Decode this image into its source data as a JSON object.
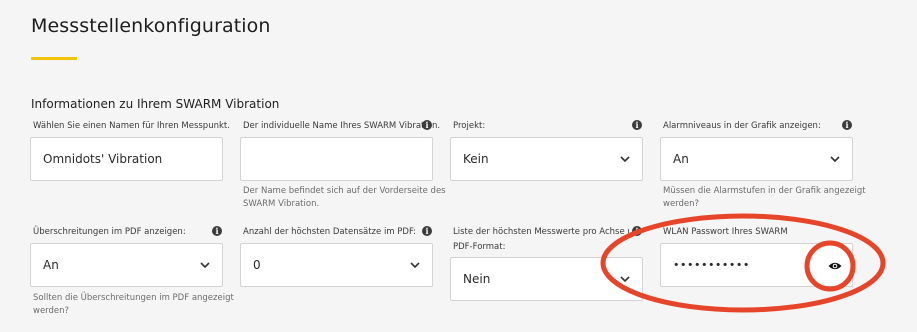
{
  "page": {
    "title": "Messstellenkonfiguration",
    "section_title": "Informationen zu Ihrem SWARM Vibration"
  },
  "fields": {
    "name": {
      "label": "Wählen Sie einen Namen für Ihren Messpunkt.",
      "value": "Omnidots' Vibration"
    },
    "individual_name": {
      "label": "Der individuelle Name Ihres SWARM Vibration.",
      "value": "",
      "hint_line1": "Der Name befindet sich auf der Vorderseite des",
      "hint_line2": "SWARM Vibration."
    },
    "project": {
      "label": "Projekt:",
      "value": "Kein"
    },
    "alarm_levels": {
      "label": "Alarmniveaus in der Grafik anzeigen:",
      "value": "An",
      "hint_line1": "Müssen die Alarmstufen in der Grafik angezeigt",
      "hint_line2": "werden?"
    },
    "exceedances_pdf": {
      "label": "Überschreitungen im PDF anzeigen:",
      "value": "An",
      "hint_line1": "Sollten die Überschreitungen im PDF angezeigt",
      "hint_line2": "werden?"
    },
    "max_records_pdf": {
      "label": "Anzahl der höchsten Datensätze im PDF:",
      "value": "0"
    },
    "peak_list_pdf": {
      "label_line1": "Liste der höchsten Messwerte pro Achse und Tag im",
      "label_line2": "PDF-Format:",
      "value": "Nein"
    },
    "wifi_password": {
      "label": "WLAN Passwort Ihres SWARM",
      "value": "•••••••••••"
    }
  },
  "icons": {
    "info": "info-icon",
    "chevron": "chevron-down-icon",
    "eye": "eye-icon"
  },
  "colors": {
    "accent": "#f2c500",
    "annotation": "#e6452a",
    "info_icon": "#3c3c3c"
  }
}
